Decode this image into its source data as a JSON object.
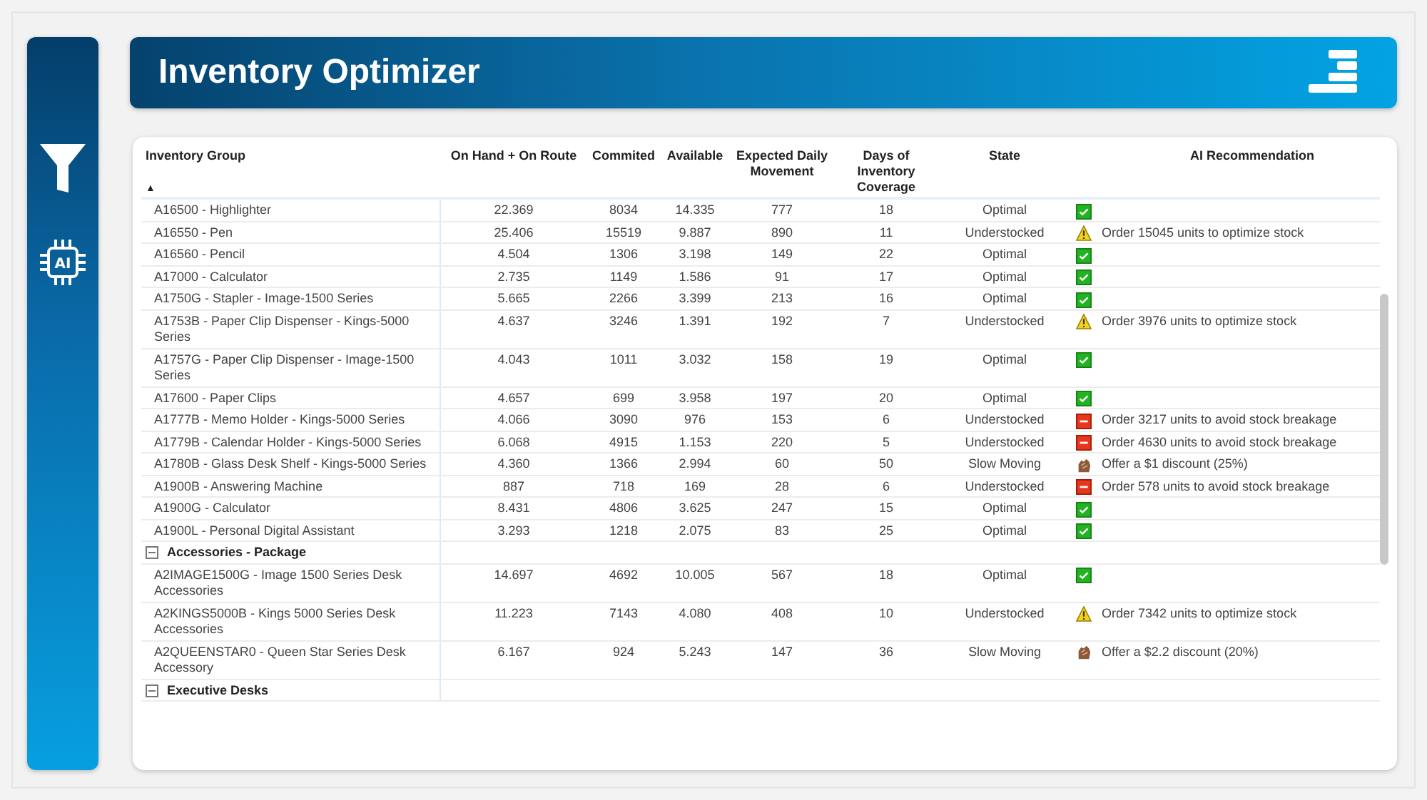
{
  "title": "Inventory Optimizer",
  "sidebar": {
    "chip_label": "AI"
  },
  "table": {
    "columns": [
      "Inventory Group",
      "On Hand + On Route",
      "Commited",
      "Available",
      "Expected Daily Movement",
      "Days of Inventory Coverage",
      "State",
      "AI Recommendation"
    ],
    "sort_indicator": "▲",
    "rows": [
      {
        "kind": "optimal",
        "cells": [
          "A16500 - Highlighter",
          "22.369",
          "8034",
          "14.335",
          "777",
          "18",
          "Optimal"
        ]
      },
      {
        "kind": "understocked",
        "cells": [
          "A16550 - Pen",
          "25.406",
          "15519",
          "9.887",
          "890",
          "11",
          "Understocked"
        ],
        "recommendation": "Order 15045 units to optimize stock"
      },
      {
        "kind": "optimal",
        "cells": [
          "A16560 - Pencil",
          "4.504",
          "1306",
          "3.198",
          "149",
          "22",
          "Optimal"
        ]
      },
      {
        "kind": "optimal",
        "cells": [
          "A17000 - Calculator",
          "2.735",
          "1149",
          "1.586",
          "91",
          "17",
          "Optimal"
        ]
      },
      {
        "kind": "optimal",
        "cells": [
          "A1750G - Stapler - Image-1500 Series",
          "5.665",
          "2266",
          "3.399",
          "213",
          "16",
          "Optimal"
        ]
      },
      {
        "kind": "understocked",
        "cells": [
          "A1753B - Paper Clip Dispenser - Kings-5000 Series",
          "4.637",
          "3246",
          "1.391",
          "192",
          "7",
          "Understocked"
        ],
        "recommendation": "Order 3976 units to optimize stock"
      },
      {
        "kind": "optimal",
        "cells": [
          "A1757G - Paper Clip Dispenser - Image-1500 Series",
          "4.043",
          "1011",
          "3.032",
          "158",
          "19",
          "Optimal"
        ]
      },
      {
        "kind": "optimal",
        "cells": [
          "A17600 - Paper Clips",
          "4.657",
          "699",
          "3.958",
          "197",
          "20",
          "Optimal"
        ]
      },
      {
        "kind": "critical",
        "cells": [
          "A1777B - Memo Holder - Kings-5000 Series",
          "4.066",
          "3090",
          "976",
          "153",
          "6",
          "Understocked"
        ],
        "recommendation": "Order 3217 units to avoid stock breakage"
      },
      {
        "kind": "critical",
        "cells": [
          "A1779B - Calendar Holder - Kings-5000 Series",
          "6.068",
          "4915",
          "1.153",
          "220",
          "5",
          "Understocked"
        ],
        "recommendation": "Order 4630 units to avoid stock breakage"
      },
      {
        "kind": "slow",
        "cells": [
          "A1780B - Glass Desk Shelf - Kings-5000 Series",
          "4.360",
          "1366",
          "2.994",
          "60",
          "50",
          "Slow Moving"
        ],
        "recommendation": "Offer a $1 discount (25%)"
      },
      {
        "kind": "critical",
        "cells": [
          "A1900B - Answering Machine",
          "887",
          "718",
          "169",
          "28",
          "6",
          "Understocked"
        ],
        "recommendation": "Order 578 units to avoid stock breakage"
      },
      {
        "kind": "optimal",
        "cells": [
          "A1900G - Calculator",
          "8.431",
          "4806",
          "3.625",
          "247",
          "15",
          "Optimal"
        ]
      },
      {
        "kind": "optimal",
        "cells": [
          "A1900L - Personal Digital Assistant",
          "3.293",
          "1218",
          "2.075",
          "83",
          "25",
          "Optimal"
        ]
      },
      {
        "kind": "group",
        "label": "Accessories - Package",
        "expanded": true
      },
      {
        "kind": "optimal",
        "cells": [
          "A2IMAGE1500G - Image 1500 Series Desk Accessories",
          "14.697",
          "4692",
          "10.005",
          "567",
          "18",
          "Optimal"
        ]
      },
      {
        "kind": "understocked",
        "cells": [
          "A2KINGS5000B - Kings 5000 Series Desk Accessories",
          "11.223",
          "7143",
          "4.080",
          "408",
          "10",
          "Understocked"
        ],
        "recommendation": "Order 7342 units to optimize stock"
      },
      {
        "kind": "slow",
        "cells": [
          "A2QUEENSTAR0 - Queen Star Series Desk Accessory",
          "6.167",
          "924",
          "5.243",
          "147",
          "36",
          "Slow Moving"
        ],
        "recommendation": "Offer a $2.2 discount (20%)"
      },
      {
        "kind": "group",
        "label": "Executive Desks",
        "expanded": true
      }
    ]
  }
}
